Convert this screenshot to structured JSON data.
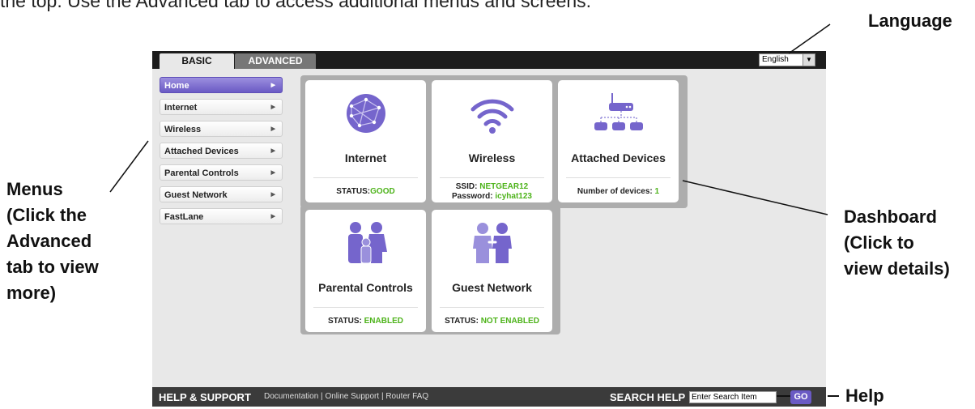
{
  "intro_text": "the top. Use the Advanced tab to access additional menus and screens.",
  "callouts": {
    "language": "Language",
    "menus": [
      "Menus",
      "(Click the",
      "Advanced",
      "tab to view",
      "more)"
    ],
    "dashboard": [
      "Dashboard",
      "(Click to",
      "view details)"
    ],
    "help": "Help"
  },
  "tabs": {
    "basic": "BASIC",
    "advanced": "ADVANCED"
  },
  "language_select": {
    "value": "English"
  },
  "menu_items": [
    "Home",
    "Internet",
    "Wireless",
    "Attached Devices",
    "Parental Controls",
    "Guest Network",
    "FastLane"
  ],
  "tiles": {
    "internet": {
      "name": "Internet",
      "status_label": "STATUS:",
      "status_value": "GOOD"
    },
    "wireless": {
      "name": "Wireless",
      "ssid_label": "SSID: ",
      "ssid_value": "NETGEAR12",
      "password_label": "Password: ",
      "password_value": "icyhat123"
    },
    "attached": {
      "name": "Attached Devices",
      "count_label": "Number of devices: ",
      "count_value": "1"
    },
    "parental": {
      "name": "Parental Controls",
      "status_label": "STATUS: ",
      "status_value": "ENABLED"
    },
    "guest": {
      "name": "Guest Network",
      "status_label": "STATUS: ",
      "status_value": "NOT ENABLED"
    }
  },
  "footer": {
    "title": "HELP & SUPPORT",
    "links": [
      "Documentation",
      "Online Support",
      "Router FAQ"
    ],
    "separator": "|",
    "search_label": "SEARCH HELP",
    "search_value": "Enter Search Item",
    "go_label": "GO"
  },
  "colors": {
    "accent": "#6a5ac4",
    "status_green": "#4db31a",
    "topbar": "#1d1d1d",
    "footer": "#3b3b3b"
  }
}
